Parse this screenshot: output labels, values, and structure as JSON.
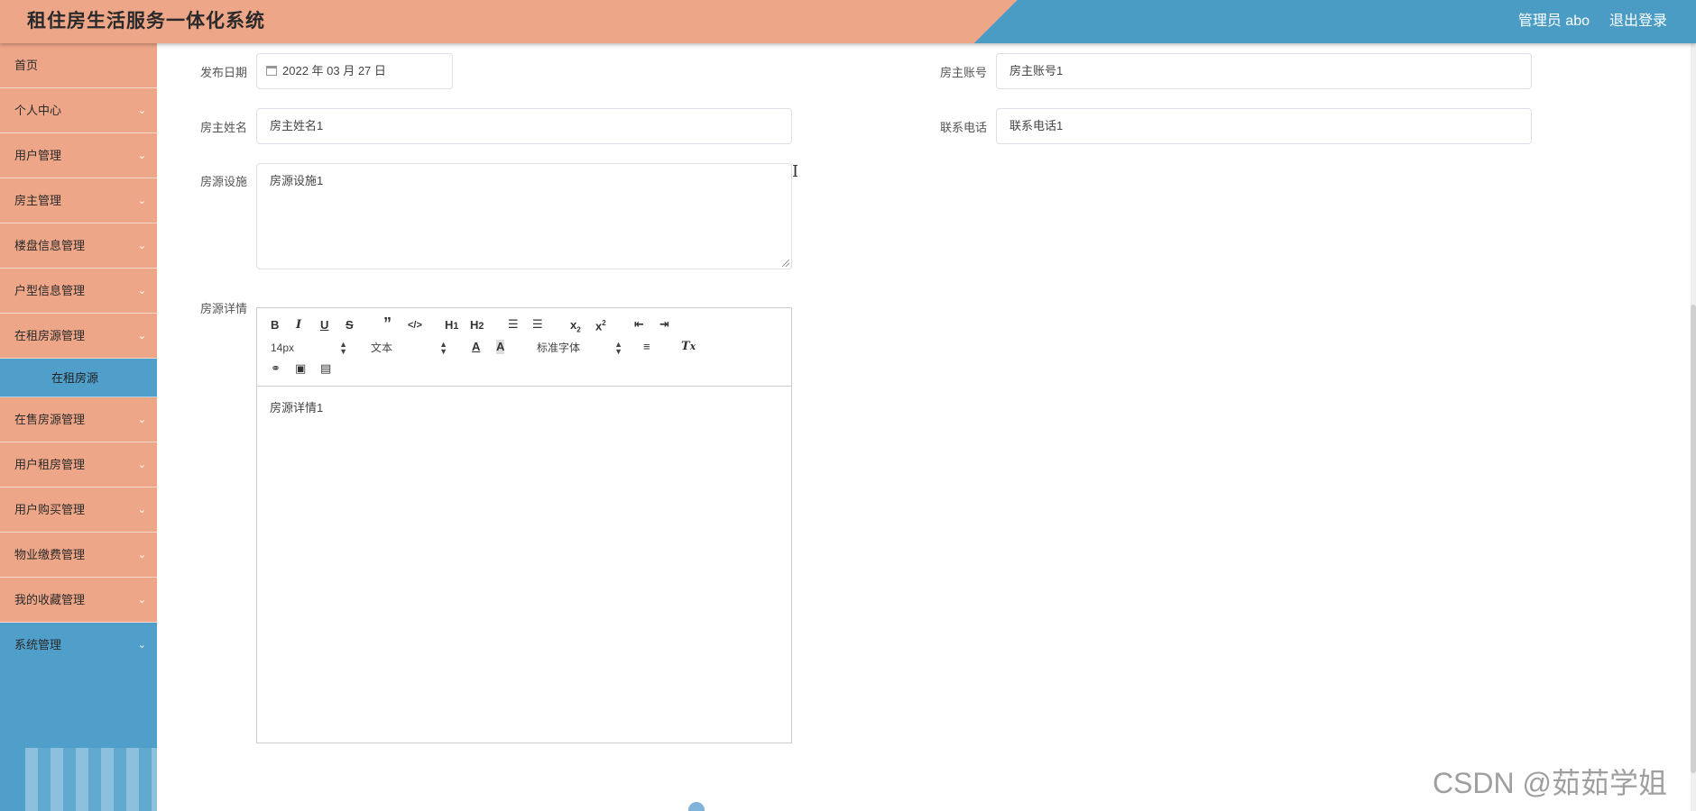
{
  "header": {
    "title": "租住房生活服务一体化系统",
    "user": "管理员 abo",
    "logout": "退出登录"
  },
  "sidebar": {
    "items": [
      {
        "label": "首页",
        "arrow": false
      },
      {
        "label": "个人中心",
        "arrow": true
      },
      {
        "label": "用户管理",
        "arrow": true
      },
      {
        "label": "房主管理",
        "arrow": true
      },
      {
        "label": "楼盘信息管理",
        "arrow": true
      },
      {
        "label": "户型信息管理",
        "arrow": true
      },
      {
        "label": "在租房源管理",
        "arrow": true
      },
      {
        "label": "在租房源",
        "arrow": false,
        "sub": true
      },
      {
        "label": "在售房源管理",
        "arrow": true
      },
      {
        "label": "用户租房管理",
        "arrow": true
      },
      {
        "label": "用户购买管理",
        "arrow": true
      },
      {
        "label": "物业缴费管理",
        "arrow": true
      },
      {
        "label": "我的收藏管理",
        "arrow": true
      },
      {
        "label": "系统管理",
        "arrow": true
      }
    ],
    "arrow_glyph": "⌄"
  },
  "form": {
    "publish_date_label": "发布日期",
    "publish_date_value": "2022 年 03 月 27 日",
    "owner_account_label": "房主账号",
    "owner_account_value": "房主账号1",
    "owner_name_label": "房主姓名",
    "owner_name_value": "房主姓名1",
    "phone_label": "联系电话",
    "phone_value": "联系电话1",
    "facilities_label": "房源设施",
    "facilities_value": "房源设施1",
    "details_label": "房源详情",
    "details_value": "房源详情1"
  },
  "editor": {
    "font_size": "14px",
    "block_type": "文本",
    "font_family": "标准字体",
    "icons": [
      "bold-icon",
      "italic-icon",
      "underline-icon",
      "strike-icon",
      "quote-icon",
      "code-icon",
      "h1-icon",
      "h2-icon",
      "ordered-list-icon",
      "bullet-list-icon",
      "subscript-icon",
      "superscript-icon",
      "outdent-icon",
      "indent-icon",
      "font-color-icon",
      "background-color-icon",
      "align-icon",
      "clear-format-icon",
      "link-icon",
      "image-icon",
      "video-icon"
    ]
  },
  "watermark": "CSDN @茹茹学姐",
  "colors": {
    "accent_salmon": "#eea688",
    "accent_blue": "#4a9cc4"
  }
}
